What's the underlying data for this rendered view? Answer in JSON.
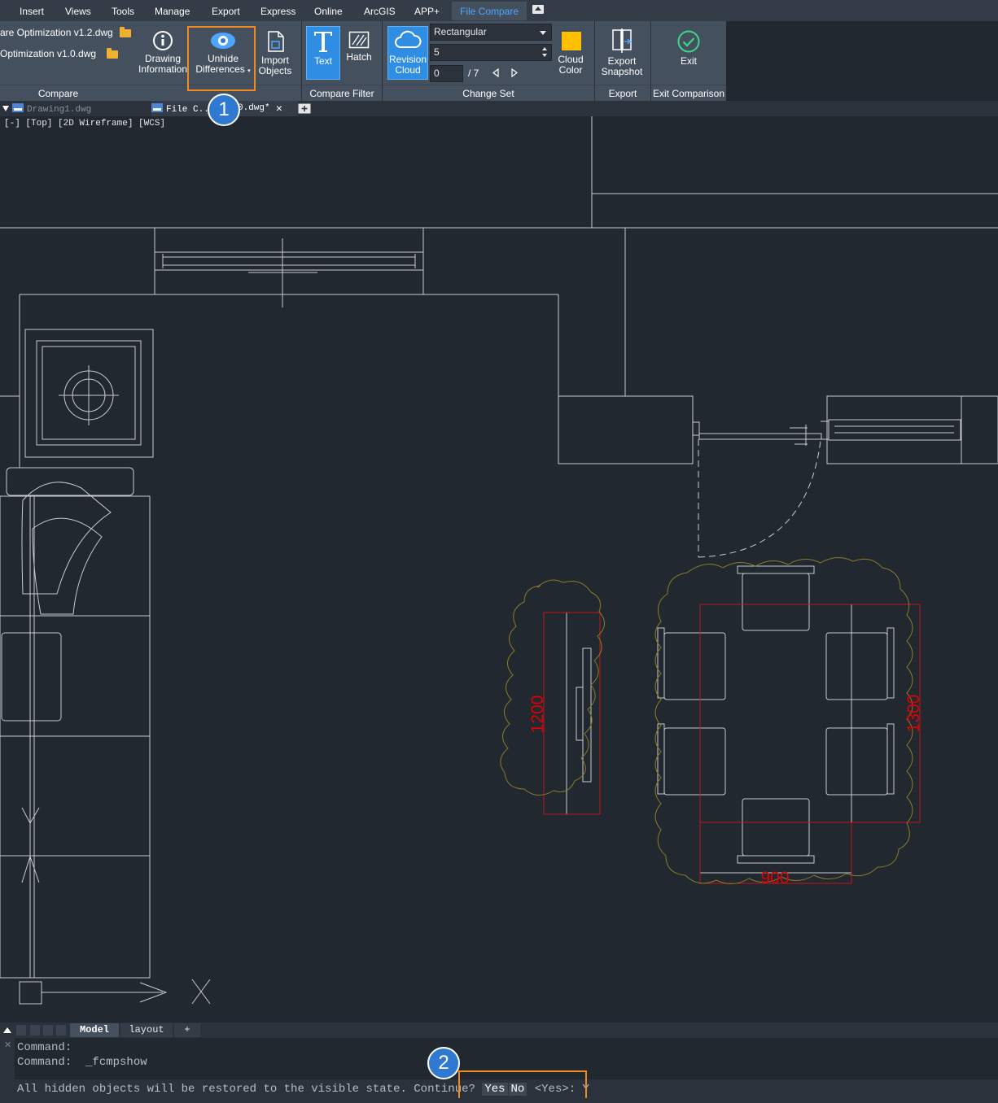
{
  "menu": {
    "items": [
      "Insert",
      "Views",
      "Tools",
      "Manage",
      "Export",
      "Express",
      "Online",
      "ArcGIS",
      "APP+",
      "File Compare"
    ],
    "active": "File Compare"
  },
  "ribbon": {
    "compare": {
      "file1": "are Optimization v1.2.dwg",
      "file2": "Optimization v1.0.dwg",
      "drawing_info": [
        "Drawing",
        "Information"
      ],
      "unhide": [
        "Unhide",
        "Differences"
      ],
      "import": [
        "Import",
        "Objects"
      ],
      "title": "Compare"
    },
    "compare_filter": {
      "text": "Text",
      "hatch": "Hatch",
      "title": "Compare Filter"
    },
    "change_set": {
      "revision_cloud": [
        "Revision",
        "Cloud"
      ],
      "shape": "Rectangular",
      "size": "5",
      "index": "0",
      "total": "/ 7",
      "cloud_color": [
        "Cloud",
        "Color"
      ],
      "cloud_color_value": "#ffc000",
      "title": "Change Set"
    },
    "export": {
      "snapshot": [
        "Export",
        "Snapshot"
      ],
      "title": "Export"
    },
    "exit": {
      "label": "Exit",
      "title": "Exit Comparison"
    }
  },
  "doc_tabs": {
    "tab1": "Drawing1.dwg",
    "tab2_left": "File C..",
    "tab2_right": "0.dwg*",
    "close": "✕"
  },
  "viewport_label": "[-] [Top] [2D Wireframe] [WCS]",
  "dimensions": {
    "d1200": "1200",
    "d1300": "1300",
    "d900": "900"
  },
  "layout_tabs": {
    "model": "Model",
    "layout": "layout",
    "add": "+"
  },
  "command": {
    "line1": "Command:",
    "line2": "Command:  _fcmpshow",
    "prompt": "All hidden objects will be restored to the visible state. Continue?",
    "opt_yes": "Yes",
    "opt_no": "No",
    "default": "<Yes>: Y"
  },
  "callouts": [
    "1",
    "2"
  ],
  "colors": {
    "highlight": "#f28a1e",
    "accent": "#2f8de4",
    "dimension": "#e00000",
    "cloud": "#8a7a28"
  }
}
